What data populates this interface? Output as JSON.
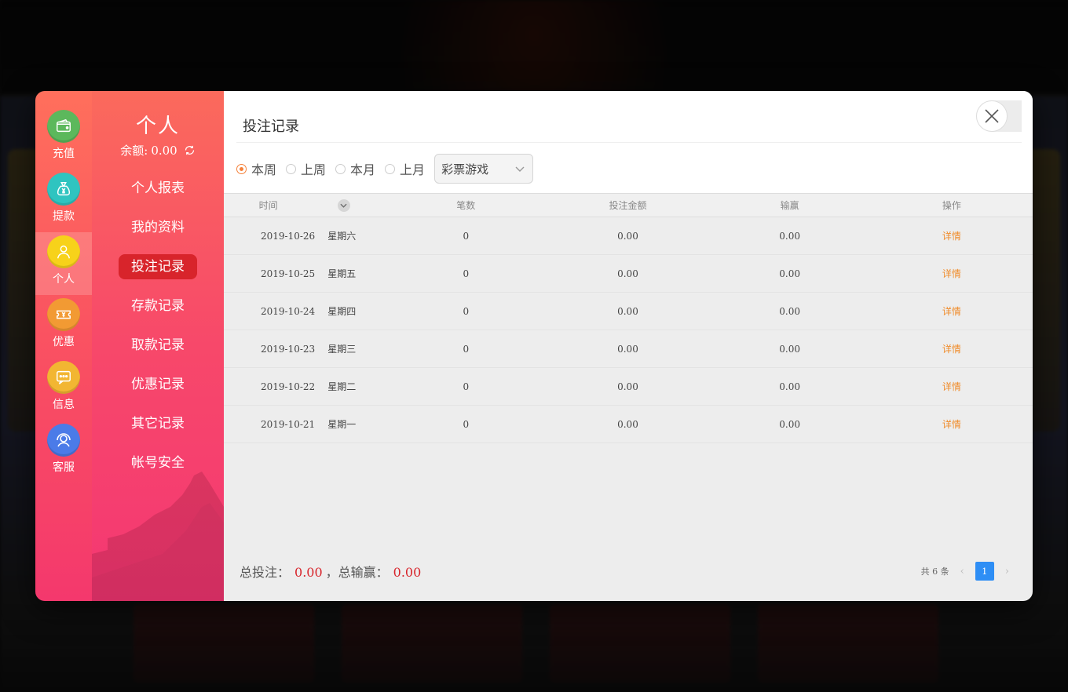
{
  "rail": {
    "items": [
      {
        "label": "充值",
        "icon": "wallet-icon",
        "color": "#5cb85c"
      },
      {
        "label": "提款",
        "icon": "money-bag-icon",
        "color": "#2fc4c0"
      },
      {
        "label": "个人",
        "icon": "user-icon",
        "color": "#f7d21a"
      },
      {
        "label": "优惠",
        "icon": "ticket-icon",
        "color": "#f29a33"
      },
      {
        "label": "信息",
        "icon": "message-icon",
        "color": "#f2b632"
      },
      {
        "label": "客服",
        "icon": "headset-icon",
        "color": "#4b7be8"
      }
    ],
    "active_index": 2
  },
  "menu": {
    "title": "个人",
    "balance_label": "余额:",
    "balance_value": "0.00",
    "items": [
      "个人报表",
      "我的资料",
      "投注记录",
      "存款记录",
      "取款记录",
      "优惠记录",
      "其它记录",
      "帐号安全"
    ],
    "active_index": 2
  },
  "content": {
    "title": "投注记录",
    "filters": {
      "radios": [
        "本周",
        "上周",
        "本月",
        "上月"
      ],
      "checked_index": 0,
      "select_value": "彩票游戏"
    },
    "table": {
      "headers": [
        "时间",
        "笔数",
        "投注金额",
        "输赢",
        "操作"
      ],
      "rows": [
        {
          "date": "2019-10-26",
          "weekday": "星期六",
          "count": "0",
          "amount": "0.00",
          "win": "0.00",
          "action": "详情"
        },
        {
          "date": "2019-10-25",
          "weekday": "星期五",
          "count": "0",
          "amount": "0.00",
          "win": "0.00",
          "action": "详情"
        },
        {
          "date": "2019-10-24",
          "weekday": "星期四",
          "count": "0",
          "amount": "0.00",
          "win": "0.00",
          "action": "详情"
        },
        {
          "date": "2019-10-23",
          "weekday": "星期三",
          "count": "0",
          "amount": "0.00",
          "win": "0.00",
          "action": "详情"
        },
        {
          "date": "2019-10-22",
          "weekday": "星期二",
          "count": "0",
          "amount": "0.00",
          "win": "0.00",
          "action": "详情"
        },
        {
          "date": "2019-10-21",
          "weekday": "星期一",
          "count": "0",
          "amount": "0.00",
          "win": "0.00",
          "action": "详情"
        }
      ]
    },
    "footer": {
      "total_bet_label": "总投注：",
      "total_bet_value": "0.00",
      "total_win_label": "，总输赢：",
      "total_win_value": "0.00"
    },
    "pager": {
      "total_text": "共 6 条",
      "current_page": "1"
    }
  },
  "colors": {
    "accent_red": "#d8242b",
    "link_orange": "#f08c2a",
    "page_blue": "#2e8ef5"
  }
}
